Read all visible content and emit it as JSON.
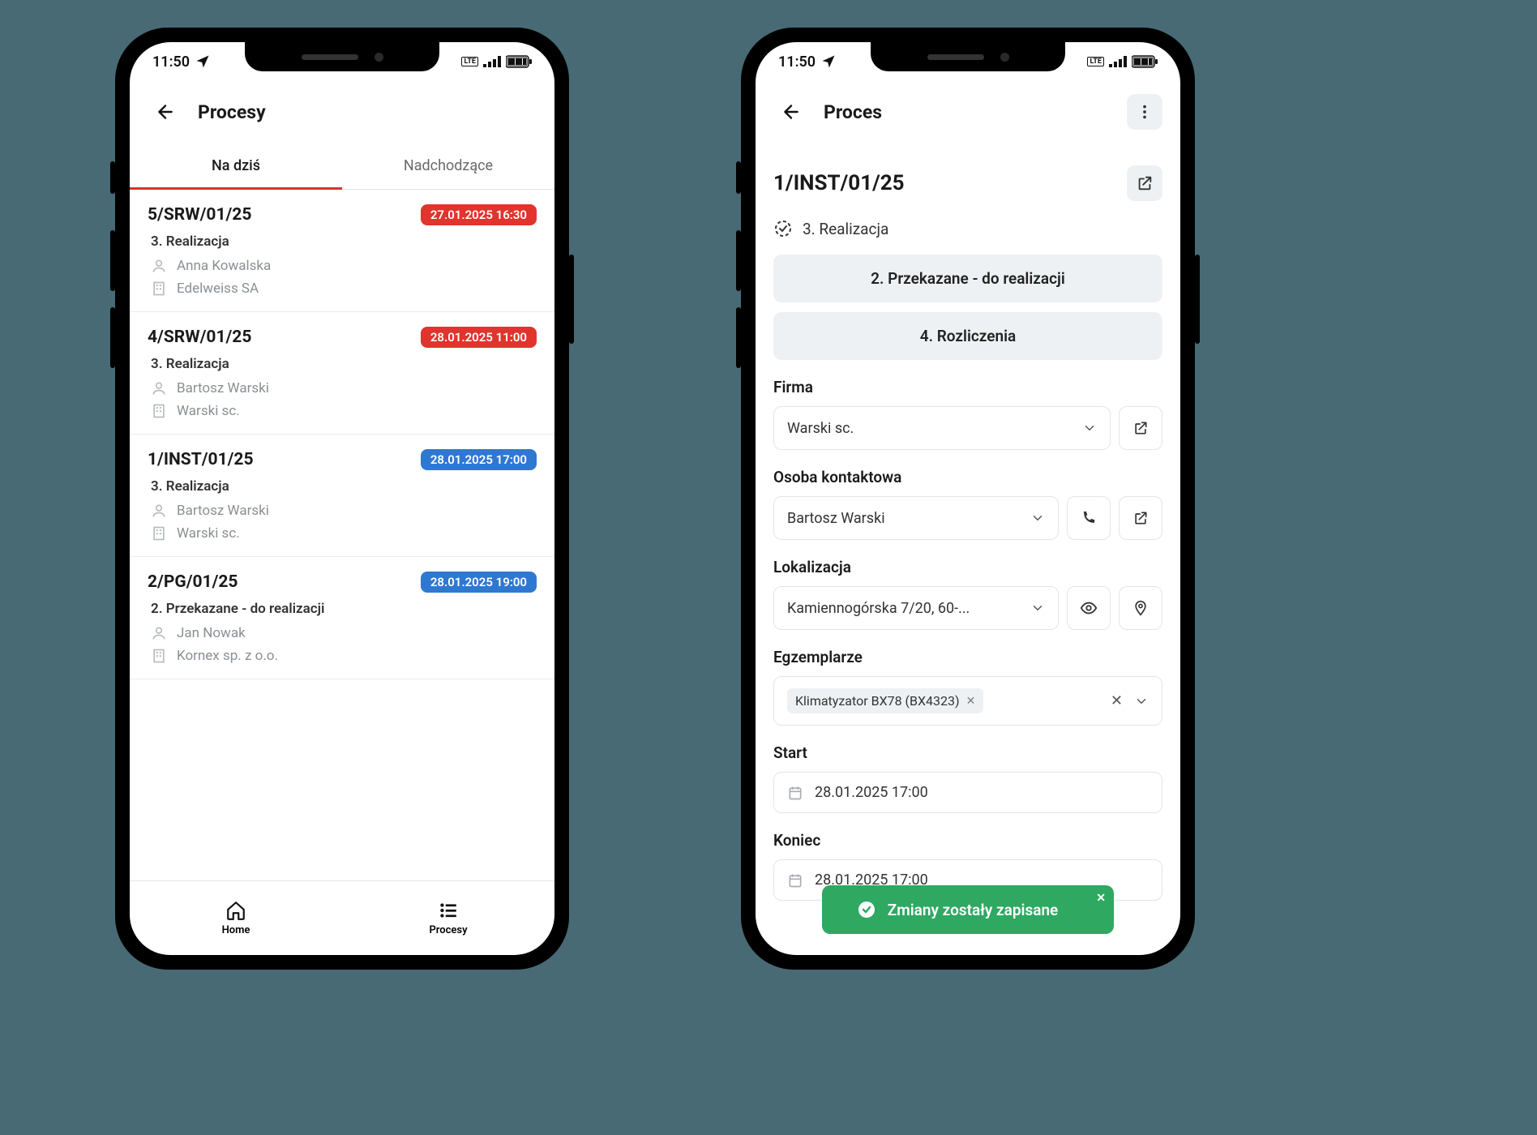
{
  "status_time": "11:50",
  "left": {
    "header_title": "Procesy",
    "tabs": {
      "today": "Na dziś",
      "upcoming": "Nadchodzące"
    },
    "items": [
      {
        "id": "5/SRW/01/25",
        "datetime": "27.01.2025 16:30",
        "badge_color": "red",
        "status": "3. Realizacja",
        "person": "Anna Kowalska",
        "company": "Edelweiss SA"
      },
      {
        "id": "4/SRW/01/25",
        "datetime": "28.01.2025 11:00",
        "badge_color": "red",
        "status": "3. Realizacja",
        "person": "Bartosz Warski",
        "company": "Warski sc."
      },
      {
        "id": "1/INST/01/25",
        "datetime": "28.01.2025 17:00",
        "badge_color": "blue",
        "status": "3. Realizacja",
        "person": "Bartosz Warski",
        "company": "Warski sc."
      },
      {
        "id": "2/PG/01/25",
        "datetime": "28.01.2025 19:00",
        "badge_color": "blue",
        "status": "2. Przekazane - do realizacji",
        "person": "Jan Nowak",
        "company": "Kornex sp. z o.o."
      }
    ],
    "nav": {
      "home": "Home",
      "processes": "Procesy"
    }
  },
  "right": {
    "header_title": "Proces",
    "process_id": "1/INST/01/25",
    "current_stage": "3. Realizacja",
    "stage_prev": "2. Przekazane - do realizacji",
    "stage_next": "4. Rozliczenia",
    "fields": {
      "company_label": "Firma",
      "company_value": "Warski sc.",
      "contact_label": "Osoba kontaktowa",
      "contact_value": "Bartosz Warski",
      "location_label": "Lokalizacja",
      "location_value": "Kamiennogórska 7/20, 60-...",
      "items_label": "Egzemplarze",
      "item_chip": "Klimatyzator BX78 (BX4323)",
      "start_label": "Start",
      "start_value": "28.01.2025 17:00",
      "end_label": "Koniec",
      "end_value": "28.01.2025 17:00"
    },
    "toast": "Zmiany zostały zapisane"
  }
}
